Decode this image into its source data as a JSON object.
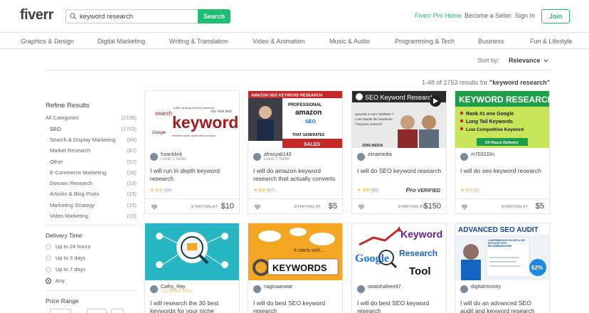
{
  "header": {
    "logo": "fiverr",
    "search_value": "keyword research",
    "search_button": "Search",
    "links": {
      "pro": "Fiverr Pro Home",
      "seller": "Become a Seller",
      "signin": "Sign In",
      "join": "Join"
    }
  },
  "categories": [
    "Graphics & Design",
    "Digital Marketing",
    "Writing & Translation",
    "Video & Animation",
    "Music & Audio",
    "Programming & Tech",
    "Business",
    "Fun & Lifestyle"
  ],
  "sort": {
    "label": "Sort by:",
    "value": "Relevance"
  },
  "results": {
    "prefix": "1-48 of 1753 results for ",
    "query": "\"keyword research\""
  },
  "sidebar": {
    "title": "Refine Results",
    "all": {
      "label": "All Categories",
      "count": "(2139)"
    },
    "subcategories": [
      {
        "label": "SEO",
        "count": "(1753)"
      },
      {
        "label": "Search & Display Marketing",
        "count": "(89)"
      },
      {
        "label": "Market Research",
        "count": "(67)"
      },
      {
        "label": "Other",
        "count": "(57)"
      },
      {
        "label": "E-Commerce Marketing",
        "count": "(28)"
      },
      {
        "label": "Domain Research",
        "count": "(18)"
      },
      {
        "label": "Articles & Blog Posts",
        "count": "(15)"
      },
      {
        "label": "Marketing Strategy",
        "count": "(15)"
      },
      {
        "label": "Video Marketing",
        "count": "(15)"
      }
    ],
    "delivery_title": "Delivery Time",
    "delivery_options": [
      "Up to 24 hours",
      "Up to 3 days",
      "Up to 7 days",
      "Any"
    ],
    "delivery_selected": "Any",
    "price_title": "Price Range"
  },
  "gigs": [
    {
      "seller": "furanklink",
      "level": "Level 2 Seller",
      "title": "I will run in depth keyword research",
      "rating": "5.0",
      "reviews": "(34)",
      "starting": "STARTING AT",
      "price": "$10",
      "image": {
        "type": "wordcloud",
        "words": [
          "keywords",
          "Google",
          "search"
        ]
      }
    },
    {
      "seller": "afrasyab143",
      "level": "Level 2 Seller",
      "title": "I will do amazon keyword research that actually converts",
      "rating": "5.0",
      "reviews": "(67)",
      "starting": "STARTING AT",
      "price": "$5",
      "image": {
        "type": "amazon",
        "banner": "AMAZON SEO KEYWORD RESEARCH",
        "lines": [
          "PROFESSIONAL",
          "amazon",
          "SEO"
        ],
        "sub": "THAT GENERATES",
        "foot": "SALES"
      }
    },
    {
      "seller": "zimamedia",
      "level": "",
      "title": "I will do SEO keyword research",
      "rating": "4.9",
      "reviews": "(30)",
      "starting": "STARTING AT",
      "price": "$150",
      "pro": true,
      "pro_text": "VERIFIED",
      "pro_mark": "Pro",
      "image": {
        "type": "video",
        "banner": "SEO Keyword Research",
        "brand": "ZIMA MEDIA"
      }
    },
    {
      "seller": "m703233n",
      "level": "",
      "title": "I will do seo keyword research",
      "rating": "5.0",
      "reviews": "(1)",
      "starting": "STARTING AT",
      "price": "$5",
      "image": {
        "type": "greenlist",
        "banner": "KEYWORD RESEARCH",
        "items": [
          "Rank #1 one Google",
          "Long Tail Keywords",
          "Low Competitive Keyword"
        ],
        "foot": "24 Hours Delivery"
      }
    },
    {
      "seller": "Cathy_Rey",
      "level": "Top Rated Seller",
      "title": "I will research the 30 best keywords for your niche",
      "image": {
        "type": "teal"
      }
    },
    {
      "seller": "naginaanwar",
      "level": "",
      "title": "I will do best SEO keyword research",
      "image": {
        "type": "keyword-key",
        "lines": [
          "It starts with...",
          "KEYWORDS"
        ]
      }
    },
    {
      "seller": "owaishafeez97",
      "level": "",
      "title": "I will do best SEO keyword research",
      "image": {
        "type": "google-tool",
        "lines": [
          "Keyword",
          "Google",
          "Research",
          "Tool"
        ]
      }
    },
    {
      "seller": "digitalministry",
      "level": "",
      "title": "I will do an advanced SEO audit and keyword research",
      "image": {
        "type": "audit",
        "banner": "ADVANCED SEO AUDIT",
        "sub": "COMPREHENSIVE ON-SITE & OFF-SITE AUDIT WITH RECOMMENDATIONS",
        "pct": "62%"
      }
    }
  ],
  "colors": {
    "brand": "#1dbf73",
    "text": "#404145",
    "star": "#ffb33e"
  }
}
